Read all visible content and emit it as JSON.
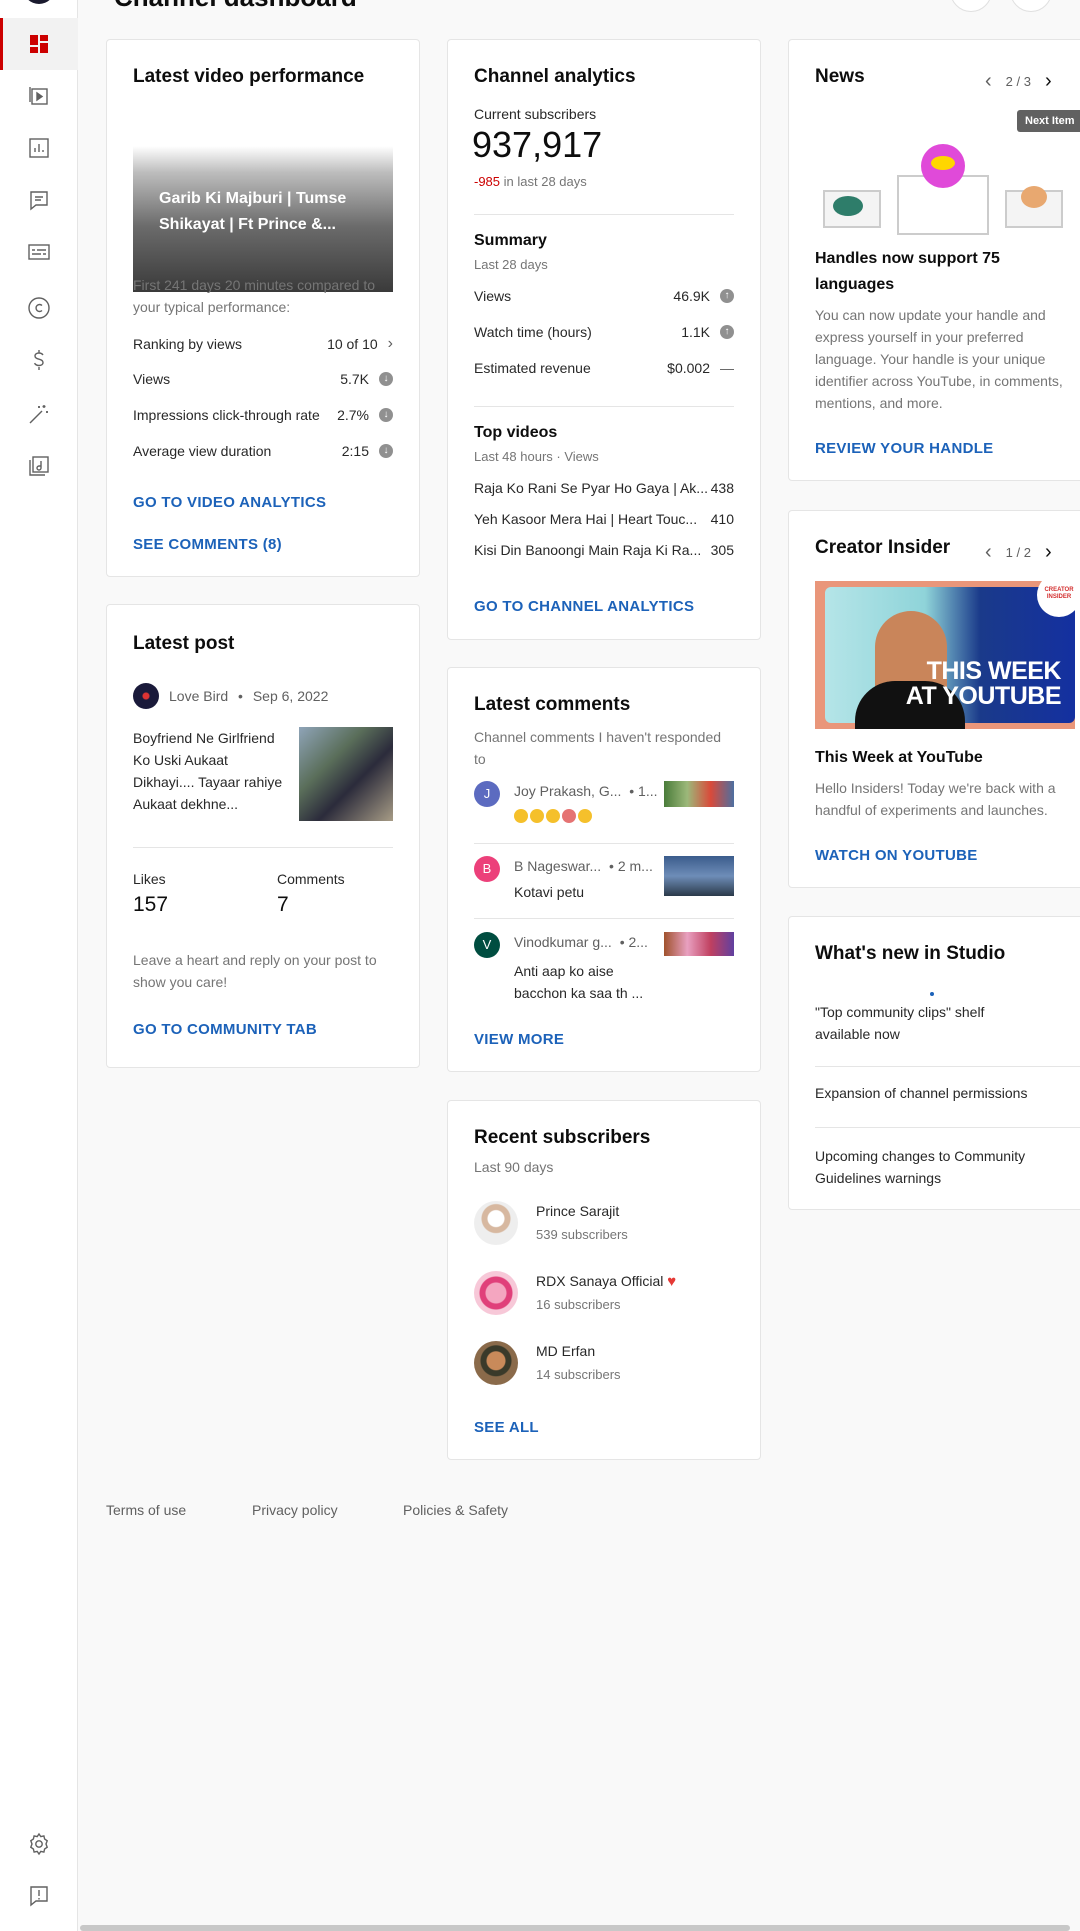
{
  "header": {
    "title": "Channel dashboard"
  },
  "sidebar": {
    "items": [
      {
        "name": "dashboard-icon"
      },
      {
        "name": "content-icon"
      },
      {
        "name": "analytics-icon"
      },
      {
        "name": "comments-icon"
      },
      {
        "name": "subtitles-icon"
      },
      {
        "name": "copyright-icon"
      },
      {
        "name": "earn-icon"
      },
      {
        "name": "customization-icon"
      },
      {
        "name": "audio-library-icon"
      },
      {
        "name": "settings-icon"
      },
      {
        "name": "feedback-icon"
      }
    ]
  },
  "latest_video": {
    "title": "Latest video performance",
    "video_title": "Garib Ki Majburi | Tumse Shikayat | Ft Prince &...",
    "compare_text": "First 241 days 20 minutes compared to your typical performance:",
    "rows": [
      {
        "label": "Ranking by views",
        "value": "10 of 10"
      },
      {
        "label": "Views",
        "value": "5.7K"
      },
      {
        "label": "Impressions click-through rate",
        "value": "2.7%"
      },
      {
        "label": "Average view duration",
        "value": "2:15"
      }
    ],
    "link_analytics": "GO TO VIDEO ANALYTICS",
    "link_comments": "SEE COMMENTS (8)"
  },
  "latest_post": {
    "title": "Latest post",
    "author": "Love Bird",
    "date": "Sep 6, 2022",
    "text": "Boyfriend Ne Girlfriend Ko Uski Aukaat Dikhayi.... Tayaar rahiye Aukaat dekhne...",
    "likes_label": "Likes",
    "likes": "157",
    "comments_label": "Comments",
    "comments": "7",
    "hint": "Leave a heart and reply on your post to show you care!",
    "link": "GO TO COMMUNITY TAB"
  },
  "channel_analytics": {
    "title": "Channel analytics",
    "subs_label": "Current subscribers",
    "subs": "937,917",
    "subs_change": "-985",
    "subs_change_suffix": "in last 28 days",
    "summary_title": "Summary",
    "summary_period": "Last 28 days",
    "summary": [
      {
        "label": "Views",
        "value": "46.9K"
      },
      {
        "label": "Watch time (hours)",
        "value": "1.1K"
      },
      {
        "label": "Estimated revenue",
        "value": "$0.002"
      }
    ],
    "top_title": "Top videos",
    "top_period": "Last 48 hours · Views",
    "top": [
      {
        "label": "Raja Ko Rani Se Pyar Ho Gaya | Ak...",
        "value": "438"
      },
      {
        "label": "Yeh Kasoor Mera Hai | Heart Touc...",
        "value": "410"
      },
      {
        "label": "Kisi Din Banoongi Main Raja Ki Ra...",
        "value": "305"
      }
    ],
    "link": "GO TO CHANNEL ANALYTICS"
  },
  "latest_comments": {
    "title": "Latest comments",
    "subtitle": "Channel comments I haven't responded to",
    "items": [
      {
        "initial": "J",
        "color": "#5c6bc0",
        "author": "Joy Prakash, G...",
        "time": "• 1...",
        "text": ""
      },
      {
        "initial": "B",
        "color": "#ec407a",
        "author": "B Nageswar...",
        "time": "• 2 m...",
        "text": "Kotavi petu"
      },
      {
        "initial": "V",
        "color": "#004d40",
        "author": "Vinodkumar g...",
        "time": "• 2...",
        "text": "Anti aap ko aise bacchon ka saa th ..."
      }
    ],
    "link": "VIEW MORE"
  },
  "recent_subscribers": {
    "title": "Recent subscribers",
    "period": "Last 90 days",
    "items": [
      {
        "name": "Prince Sarajit",
        "subs": "539 subscribers"
      },
      {
        "name": "RDX Sanaya Official",
        "subs": "16 subscribers"
      },
      {
        "name": "MD Erfan",
        "subs": "14 subscribers"
      }
    ],
    "link": "SEE ALL"
  },
  "news": {
    "title": "News",
    "pager": "2 / 3",
    "tooltip": "Next Item",
    "headline": "Handles now support 75 languages",
    "body": "You can now update your handle and express yourself in your preferred language. Your handle is your unique identifier across YouTube, in comments, mentions, and more.",
    "link": "REVIEW YOUR HANDLE"
  },
  "creator_insider": {
    "title": "Creator Insider",
    "pager": "1 / 2",
    "thumb_text_1": "THIS WEEK",
    "thumb_text_2": "AT YOUTUBE",
    "badge": "CREATOR INSIDER",
    "headline": "This Week at YouTube",
    "body": "Hello Insiders! Today we're back with a handful of experiments and launches.",
    "link": "WATCH ON YOUTUBE"
  },
  "whats_new": {
    "title": "What's new in Studio",
    "items": [
      "\"Top community clips\" shelf available now",
      "Expansion of channel permissions",
      "Upcoming changes to Community Guidelines warnings"
    ]
  },
  "footer": {
    "terms": "Terms of use",
    "privacy": "Privacy policy",
    "policies": "Policies & Safety"
  },
  "colors": {
    "accent_red": "#cc0000",
    "link_blue": "#1c62b9",
    "negative": "#cc0000"
  }
}
